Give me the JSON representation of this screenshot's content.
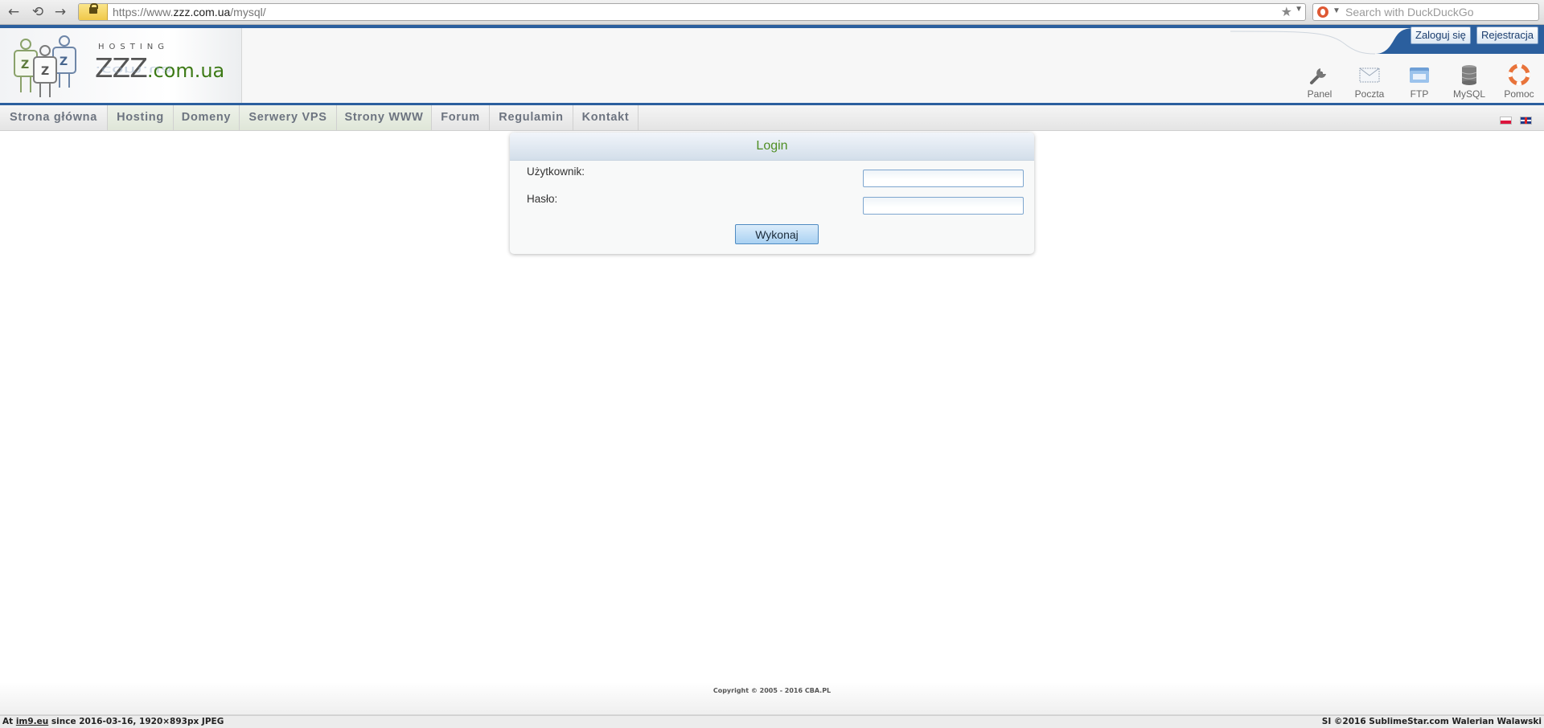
{
  "browser": {
    "url_prefix": "https://www.",
    "url_domain": "zzz.com.ua",
    "url_path": "/mysql/",
    "search_placeholder": "Search with DuckDuckGo"
  },
  "logo": {
    "hosting": "HOSTING",
    "name": "ZZZ",
    "tld": ".com.ua"
  },
  "header": {
    "login_label": "Zaloguj się",
    "register_label": "Rejestracja",
    "quick_links": [
      {
        "label": "Panel",
        "icon": "wrench-icon"
      },
      {
        "label": "Poczta",
        "icon": "envelope-icon"
      },
      {
        "label": "FTP",
        "icon": "ftp-folder-icon"
      },
      {
        "label": "MySQL",
        "icon": "database-icon"
      },
      {
        "label": "Pomoc",
        "icon": "lifebuoy-icon"
      }
    ]
  },
  "nav": {
    "items": [
      {
        "label": "Strona główna"
      },
      {
        "label": "Hosting"
      },
      {
        "label": "Domeny"
      },
      {
        "label": "Serwery VPS"
      },
      {
        "label": "Strony WWW"
      },
      {
        "label": "Forum"
      },
      {
        "label": "Regulamin"
      },
      {
        "label": "Kontakt"
      }
    ],
    "languages": [
      "pl-flag-icon",
      "en-flag-icon"
    ]
  },
  "login": {
    "title": "Login",
    "user_label": "Użytkownik:",
    "user_value": "",
    "password_label": "Hasło:",
    "password_value": "",
    "submit_label": "Wykonaj"
  },
  "footer": {
    "copyright": "Copyright © 2005 - 2016 CBA.PL"
  },
  "image_host": {
    "at": "At",
    "link": "im9.eu",
    "since": "since 2016-03-16, 1920×893px JPEG",
    "credit": "SI ©2016 SublimeStar.com Walerian Walawski"
  },
  "colors": {
    "accent_blue": "#2b5f9e",
    "login_title_green": "#4f8e23",
    "tld_green": "#3d7a16"
  }
}
